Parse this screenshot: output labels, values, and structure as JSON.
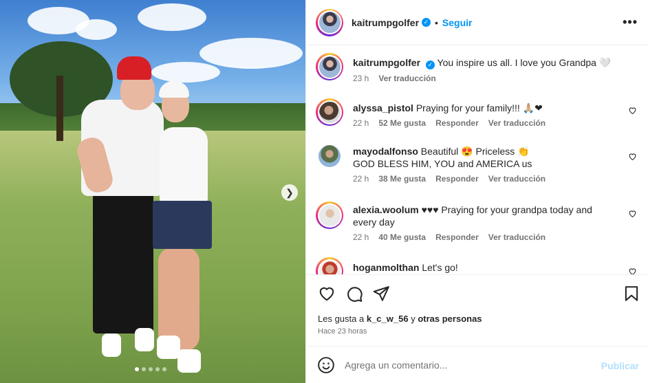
{
  "colors": {
    "accent": "#0095f6",
    "text": "#262626",
    "muted": "#737373",
    "publish_disabled": "#b2dffc"
  },
  "media": {
    "carousel_position": {
      "current": 1,
      "total": 5
    }
  },
  "header": {
    "username": "kaitrumpgolfer",
    "separator": "•",
    "follow_label": "Seguir",
    "more_icon": "more-horizontal-icon",
    "more_glyph": "•••"
  },
  "caption": {
    "username": "kaitrumpgolfer",
    "text": "You inspire us all. I love you Grandpa 🤍",
    "time": "23 h",
    "translate": "Ver traducción"
  },
  "comments": [
    {
      "username": "alyssa_pistol",
      "text": "Praying for your family!!! 🙏🏼❤",
      "time": "22 h",
      "likes": "52 Me gusta",
      "reply": "Responder",
      "translate": "Ver traducción"
    },
    {
      "username": "mayodalfonso",
      "text": "Beautiful 😍 Priceless 👏",
      "text2": "GOD BLESS HIM, YOU and AMERICA us",
      "time": "22 h",
      "likes": "38 Me gusta",
      "reply": "Responder",
      "translate": "Ver traducción"
    },
    {
      "username": "alexia.woolum",
      "text": "♥♥♥ Praying for your grandpa today and",
      "text2": "every day",
      "time": "22 h",
      "likes": "40 Me gusta",
      "reply": "Responder",
      "translate": "Ver traducción"
    },
    {
      "username": "hoganmolthan",
      "text": "Let's go!"
    }
  ],
  "likes": {
    "prefix": "Les gusta a",
    "user": "k_c_w_56",
    "middle": "y",
    "others": "otras personas"
  },
  "posted": "Hace 23 horas",
  "add_comment": {
    "placeholder": "Agrega un comentario...",
    "publish": "Publicar"
  }
}
